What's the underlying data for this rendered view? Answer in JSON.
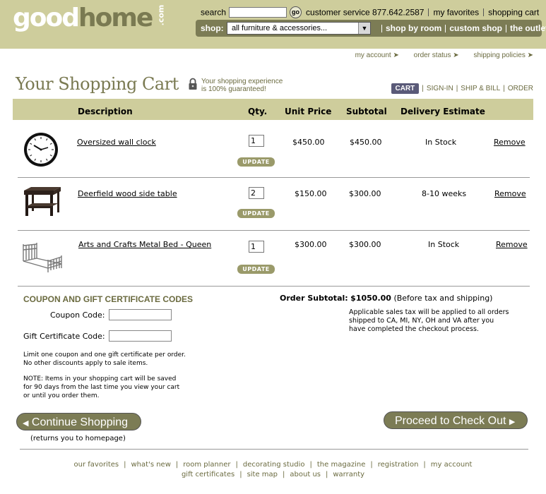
{
  "brand": {
    "logo_good": "good",
    "logo_home": "home",
    "logo_com": ".com"
  },
  "header": {
    "search_label": "search",
    "go_label": "go",
    "customer_service": "customer service 877.642.2587",
    "favorites": "my favorites",
    "cart": "shopping cart",
    "shop_label": "shop:",
    "shop_select_value": "all furniture & accessories...",
    "shop_links": [
      "shop by room",
      "custom shop",
      "the outlet"
    ]
  },
  "sub_nav": [
    "my account",
    "order status",
    "shipping policies"
  ],
  "page": {
    "title": "Your Shopping Cart",
    "guarantee_line1": "Your shopping experience",
    "guarantee_line2": "is 100% guaranteed!",
    "steps": [
      "CART",
      "SIGN-IN",
      "SHIP & BILL",
      "ORDER"
    ]
  },
  "table": {
    "headers": [
      "Description",
      "Qty.",
      "Unit Price",
      "Subtotal",
      "Delivery Estimate"
    ],
    "items": [
      {
        "name": "Oversized wall clock",
        "qty": "1",
        "unit_price": "$450.00",
        "subtotal": "$450.00",
        "delivery": "In Stock",
        "update": "UPDATE",
        "remove": "Remove"
      },
      {
        "name": "Deerfield wood side table",
        "qty": "2",
        "unit_price": "$150.00",
        "subtotal": "$300.00",
        "delivery": "8-10 weeks",
        "update": "UPDATE",
        "remove": "Remove"
      },
      {
        "name": "Arts and Crafts Metal Bed - Queen",
        "qty": "1",
        "unit_price": "$300.00",
        "subtotal": "$300.00",
        "delivery": "In Stock",
        "update": "UPDATE",
        "remove": "Remove"
      }
    ]
  },
  "coupon": {
    "title": "COUPON AND GIFT CERTIFICATE CODES",
    "coupon_label": "Coupon Code:",
    "coupon_value": "",
    "gift_label": "Gift Certificate Code:",
    "gift_value": "",
    "limit_note_1": "Limit one coupon and one gift certificate per order.",
    "limit_note_2": "No other discounts apply to sale items.",
    "save_note_1": "NOTE: Items in your shopping cart will be saved",
    "save_note_2": "for 90 days from the last time you view your cart",
    "save_note_3": "or until you order them."
  },
  "summary": {
    "label": "Order Subtotal:",
    "amount": "$1050.00",
    "qualifier": "(Before tax and shipping)",
    "tax_note": "Applicable sales tax will be applied to all orders shipped to CA, MI, NY, OH and VA after you have completed the checkout process."
  },
  "actions": {
    "continue": "Continue Shopping",
    "continue_note": "(returns you to homepage)",
    "checkout": "Proceed to Check Out"
  },
  "footer": {
    "row1": [
      "our favorites",
      "what's new",
      "room planner",
      "decorating studio",
      "the magazine",
      "registration",
      "my account"
    ],
    "row2": [
      "gift certificates",
      "site map",
      "about us",
      "warranty"
    ]
  },
  "colors": {
    "header_bg": "#cecd9c",
    "olive_dark": "#7c7c55",
    "olive_text": "#6b6b40",
    "step_active": "#5a5a78"
  }
}
